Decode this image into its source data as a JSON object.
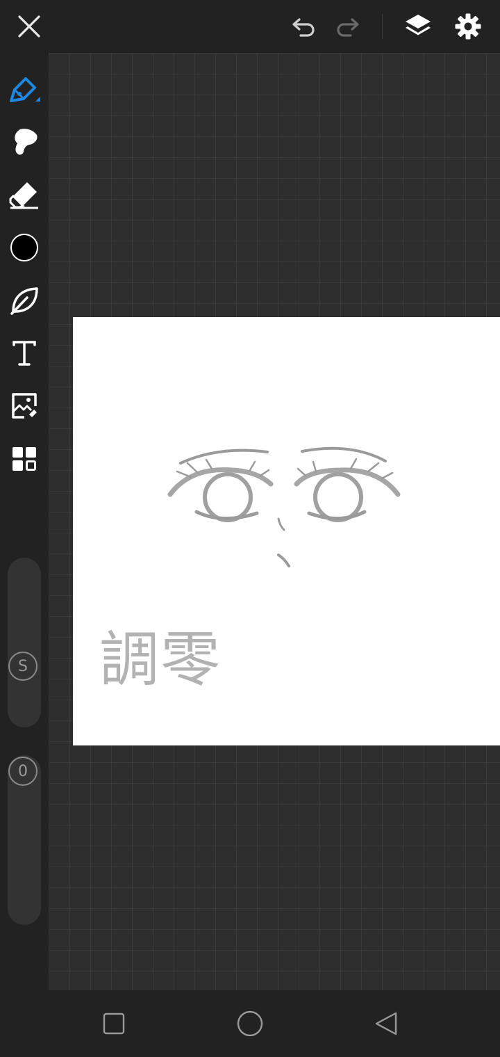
{
  "toolbar": {
    "close": "close-icon",
    "undo": "undo-icon",
    "redo": "redo-icon",
    "layers": "layers-icon",
    "settings": "gear-icon"
  },
  "tools": [
    {
      "name": "pen-tool",
      "icon": "pen-icon",
      "selected": true
    },
    {
      "name": "smudge-tool",
      "icon": "smudge-icon"
    },
    {
      "name": "eraser-tool",
      "icon": "eraser-icon"
    },
    {
      "name": "color-picker",
      "icon": "color-swatch",
      "color": "#000000"
    },
    {
      "name": "stabilizer-tool",
      "icon": "leaf-icon"
    },
    {
      "name": "text-tool",
      "icon": "text-icon"
    },
    {
      "name": "image-tool",
      "icon": "image-icon"
    },
    {
      "name": "more-tools",
      "icon": "grid-icon"
    }
  ],
  "brush_size": {
    "label": "S"
  },
  "opacity": {
    "label": "0"
  },
  "canvas": {
    "watermark_text": "調零",
    "background": "#ffffff"
  },
  "colors": {
    "accent": "#1e88e5",
    "ui_dark": "#222222",
    "grid_bg": "#2e2e2e"
  },
  "system_nav": {
    "recent": "square-icon",
    "home": "circle-icon",
    "back": "triangle-back-icon"
  }
}
